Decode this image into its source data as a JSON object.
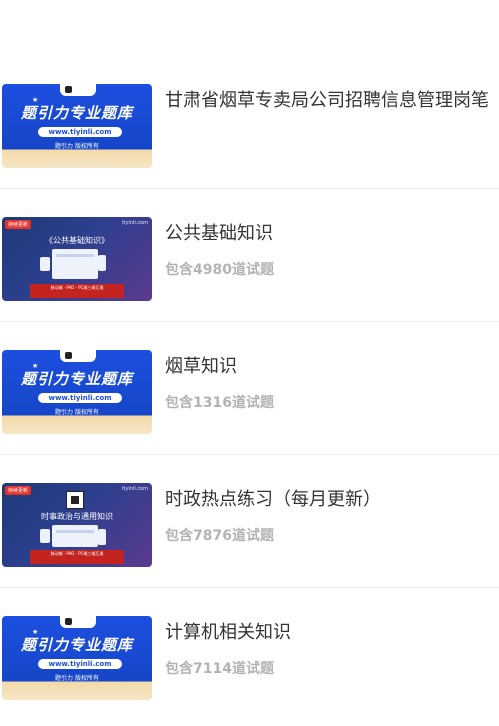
{
  "items": [
    {
      "title": "甘肃省烟草专卖局公司招聘信息管理岗笔",
      "count": "",
      "thumb": "brand"
    },
    {
      "title": "公共基础知识",
      "count": "包含4980道试题",
      "thumb": "course",
      "thumb_title": "《公共基础知识》"
    },
    {
      "title": "烟草知识",
      "count": "包含1316道试题",
      "thumb": "brand"
    },
    {
      "title": "时政热点练习（每月更新）",
      "count": "包含7876道试题",
      "thumb": "course",
      "thumb_title": "时事政治与通用知识"
    },
    {
      "title": "计算机相关知识",
      "count": "包含7114道试题",
      "thumb": "brand"
    }
  ],
  "brand_thumb": {
    "headline": "题引力专业题库",
    "url": "www.tiyinli.com",
    "footer": "题引力 版权所有"
  },
  "course_thumb": {
    "tag": "持续更新",
    "site": "tiyinli.com",
    "banner": "移动端 · PAD · PC端三端互通"
  },
  "colors": {
    "title": "#333333",
    "count": "#b3b3b3",
    "divider": "#eeeeee",
    "brand_blue": "#1d4fe0"
  }
}
